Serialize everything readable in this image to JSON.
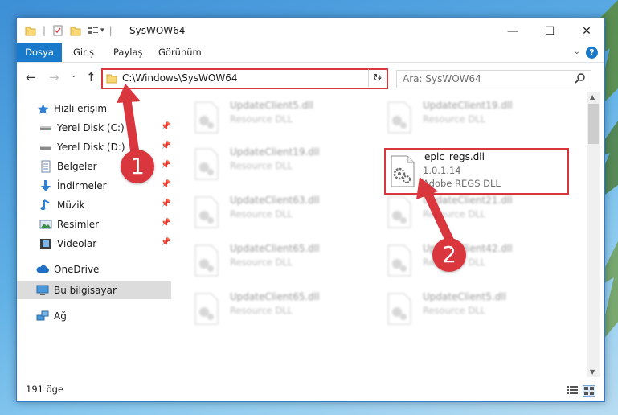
{
  "window": {
    "title": "SysWOW64",
    "controls": {
      "minimize": "—",
      "maximize": "☐",
      "close": "✕"
    }
  },
  "ribbon": {
    "tabs": [
      {
        "label": "Dosya"
      },
      {
        "label": "Giriş"
      },
      {
        "label": "Paylaş"
      },
      {
        "label": "Görünüm"
      }
    ],
    "help": "?"
  },
  "navbar": {
    "address": "C:\\Windows\\SysWOW64",
    "search_placeholder": "Ara: SysWOW64"
  },
  "sidebar": {
    "quick_access": "Hızlı erişim",
    "items": [
      {
        "label": "Yerel Disk (C:)"
      },
      {
        "label": "Yerel Disk (D:)"
      },
      {
        "label": "Belgeler"
      },
      {
        "label": "İndirmeler"
      },
      {
        "label": "Müzik"
      },
      {
        "label": "Resimler"
      },
      {
        "label": "Videolar"
      }
    ],
    "onedrive": "OneDrive",
    "this_pc": "Bu bilgisayar",
    "network": "Ağ"
  },
  "files": {
    "left": [
      {
        "name": "UpdateClient5.dll",
        "desc": "Resource DLL"
      },
      {
        "name": "UpdateClient19.dll",
        "desc": "Resource DLL"
      },
      {
        "name": "UpdateClient63.dll",
        "desc": "Resource DLL"
      },
      {
        "name": "UpdateClient65.dll",
        "desc": "Resource DLL"
      },
      {
        "name": "UpdateClient65.dll",
        "desc": "Resource DLL"
      }
    ],
    "right": [
      {
        "name": "UpdateClient19.dll",
        "desc": "Resource DLL"
      },
      {
        "name": "UpdateClient21.dll",
        "desc": "Resource DLL"
      },
      {
        "name": "UpdateClient42.dll",
        "desc": "Resource DLL"
      },
      {
        "name": "UpdateClient5.dll",
        "desc": "Resource DLL"
      }
    ],
    "focus": {
      "name": "epic_regs.dll",
      "version": "1.0.1.14",
      "desc": "Adobe REGS DLL"
    }
  },
  "status": {
    "count": "191 öge"
  },
  "annotations": {
    "step1": "1",
    "step2": "2",
    "color": "#d9363e"
  }
}
